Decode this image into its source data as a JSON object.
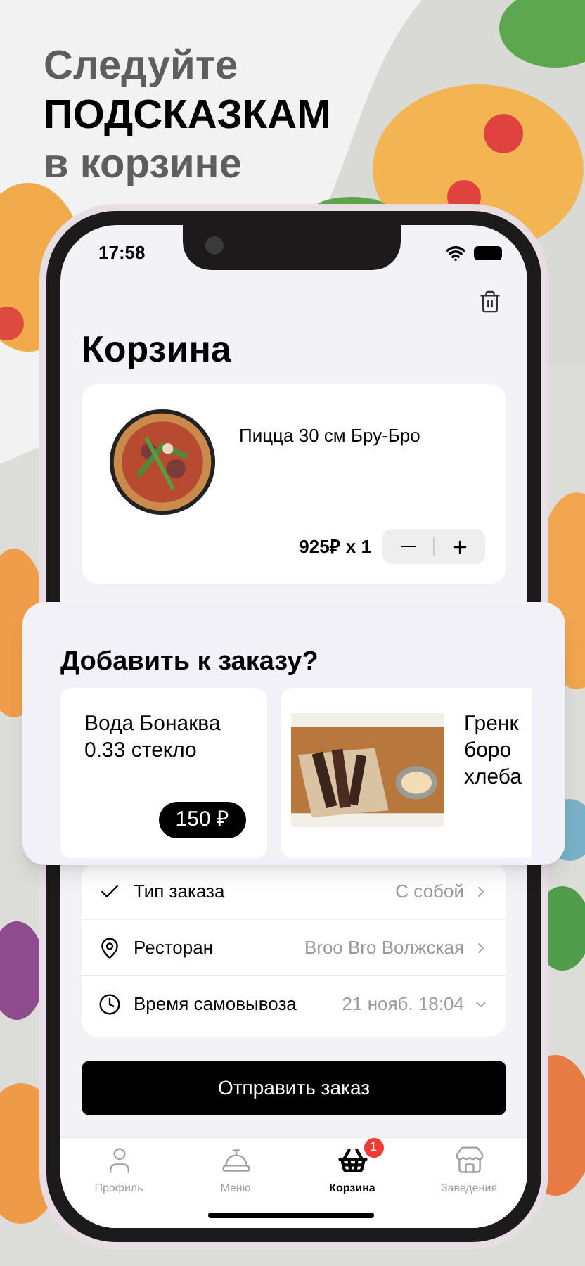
{
  "headline": {
    "lines": [
      {
        "text": "Следуйте",
        "emphasis": false
      },
      {
        "text": "ПОДСКАЗКАМ",
        "emphasis": true
      },
      {
        "text": "в корзине",
        "emphasis": false
      }
    ]
  },
  "status_bar": {
    "time": "17:58"
  },
  "page": {
    "title": "Корзина"
  },
  "cart_items": [
    {
      "name": "Пицца 30 см Бру-Бро",
      "price": "925₽ x 1"
    }
  ],
  "upsell": {
    "title": "Добавить к заказу?",
    "items": [
      {
        "kind": "text",
        "name_lines": [
          "Вода Бонаква",
          "0.33 стекло"
        ],
        "price": "150 ₽"
      },
      {
        "kind": "picture",
        "name_lines": [
          "Гренк",
          "боро",
          "хлеба"
        ]
      }
    ]
  },
  "order_options": [
    {
      "kind": "link",
      "label": "Тип заказа",
      "value": "С собой"
    },
    {
      "kind": "link",
      "label": "Ресторан",
      "value": "Broo Bro Волжская"
    },
    {
      "kind": "dropdown",
      "label": "Время самовывоза",
      "value": "21 нояб. 18:04"
    }
  ],
  "submit_button": "Отправить заказ",
  "tab_bar": [
    {
      "label": "Профиль",
      "selected": false
    },
    {
      "label": "Меню",
      "selected": false
    },
    {
      "label": "Корзина",
      "selected": true,
      "badge": "1"
    },
    {
      "label": "Заведения",
      "selected": false
    }
  ]
}
